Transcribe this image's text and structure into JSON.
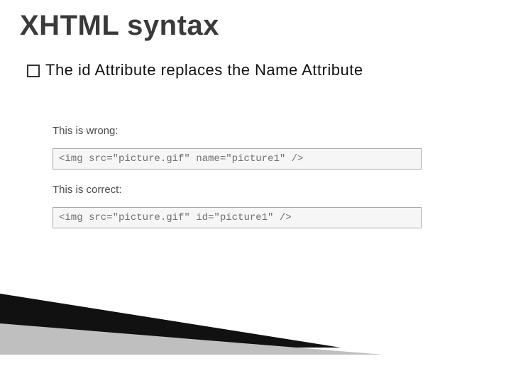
{
  "title": "XHTML syntax",
  "bullet": {
    "text": "The id Attribute replaces the Name Attribute"
  },
  "examples": {
    "wrong_label": "This is wrong:",
    "wrong_code": "<img src=\"picture.gif\" name=\"picture1\" />",
    "correct_label": "This is correct:",
    "correct_code": "<img src=\"picture.gif\" id=\"picture1\" />"
  }
}
